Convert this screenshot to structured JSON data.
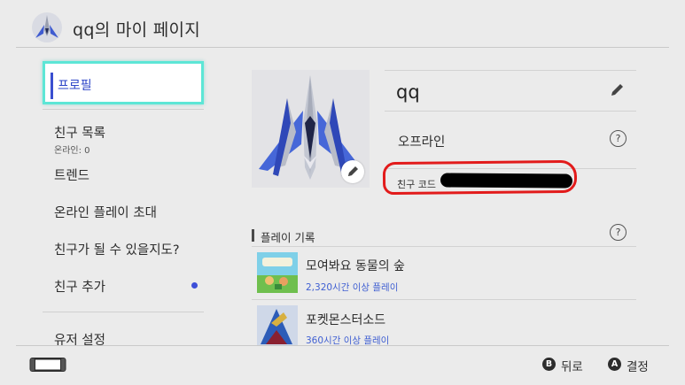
{
  "header": {
    "title": "qq의 마이 페이지",
    "avatar_icon": "arwing-ship-icon"
  },
  "sidebar": {
    "items": [
      {
        "label": "프로필"
      },
      {
        "label": "친구 목록",
        "sublabel": "온라인: 0"
      },
      {
        "label": "트렌드"
      },
      {
        "label": "온라인 플레이 초대"
      },
      {
        "label": "친구가 될 수 있을지도?"
      },
      {
        "label": "친구 추가"
      },
      {
        "label": "유저 설정"
      }
    ]
  },
  "profile": {
    "username": "qq",
    "status": "오프라인",
    "friend_code_label": "친구 코드"
  },
  "play_record": {
    "title": "플레이 기록",
    "games": [
      {
        "title": "모여봐요 동물의 숲",
        "playtime": "2,320시간 이상 플레이"
      },
      {
        "title": "포켓몬스터소드",
        "playtime": "360시간 이상 플레이"
      }
    ]
  },
  "footer": {
    "back_button": "B",
    "back_label": "뒤로",
    "confirm_button": "A",
    "confirm_label": "결정"
  },
  "colors": {
    "selection_border": "#5de6d6",
    "accent_blue": "#3d4fd8",
    "annotation_red": "#e21b1b"
  }
}
